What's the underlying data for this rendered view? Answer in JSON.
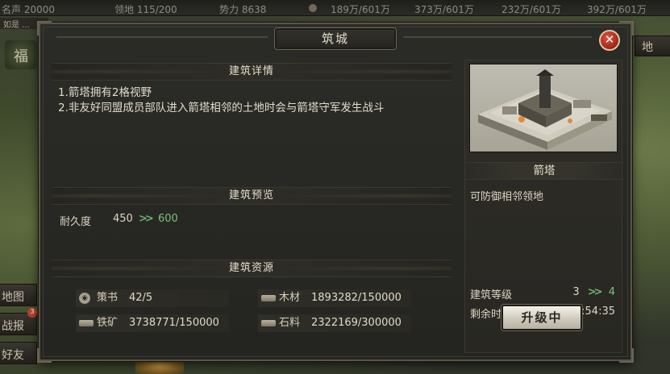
{
  "top_bar": {
    "prestige": "名声 20000",
    "territory": "领地 115/200",
    "power": "势力 8638",
    "res1": "189万/601万",
    "res2": "373万/601万",
    "res3": "232万/601万",
    "res4": "392万/601万"
  },
  "left_side": {
    "top_tab": "如是 ...",
    "emblem": "福",
    "map_btn": "地图",
    "report_btn": "战报",
    "friends_btn": "好友",
    "notify_count": "3"
  },
  "right_side": {
    "top_btn": "地"
  },
  "dialog": {
    "title": "筑城",
    "close_label": "✕",
    "detail_header": "建筑详情",
    "detail_lines": [
      "1.箭塔拥有2格视野",
      "2.非友好同盟成员部队进入箭塔相邻的土地时会与箭塔守军发生战斗"
    ],
    "preview_header": "建筑预览",
    "durability_label": "耐久度",
    "durability_from": "450",
    "durability_arrow": ">>",
    "durability_to": "600",
    "resource_header": "建筑资源",
    "resources": [
      {
        "icon": "scroll-icon",
        "label": "策书",
        "value": "42/5"
      },
      {
        "icon": "wood-icon",
        "label": "木材",
        "value": "1893282/150000"
      },
      {
        "icon": "iron-icon",
        "label": "铁矿",
        "value": "3738771/150000"
      },
      {
        "icon": "stone-icon",
        "label": "石料",
        "value": "2322169/300000"
      }
    ],
    "building": {
      "name": "箭塔",
      "description": "可防御相邻领地",
      "level_label": "建筑等级",
      "level_from": "3",
      "level_arrow": ">>",
      "level_to": "4",
      "time_label": "剩余时间",
      "time_value": "10:54:35",
      "upgrade_button": "升级中"
    }
  },
  "colors": {
    "accent_green": "#7cc47a",
    "close_red": "#c0392b",
    "panel_bg": "#282722"
  }
}
